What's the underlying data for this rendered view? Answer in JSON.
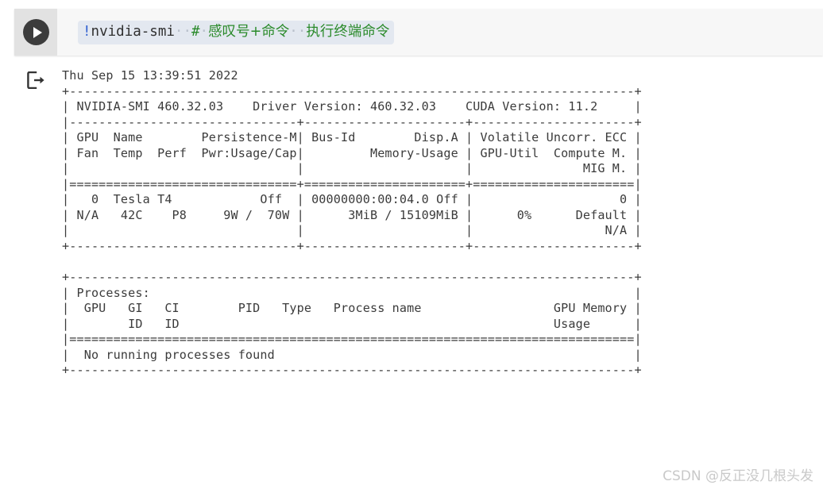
{
  "cell": {
    "run_button_icon": "play-icon",
    "output_icon": "output-export-icon",
    "code": {
      "bang": "!",
      "command": "nvidia-smi",
      "space_dots_1": "··",
      "hash": "#",
      "space_dot_2": "·",
      "comment_1": "感叹号+命令",
      "space_dots_3": "··",
      "comment_2": "执行终端命令",
      "full_text": "!nvidia-smi  # 感叹号+命令  执行终端命令"
    }
  },
  "output": {
    "timestamp": "Thu Sep 15 13:39:51 2022",
    "smi_version": "460.32.03",
    "driver_version": "460.32.03",
    "cuda_version": "11.2",
    "gpu": {
      "index": "0",
      "name": "Tesla T4",
      "persistence_m": "Off",
      "bus_id": "00000000:00:04.0",
      "disp_a": "Off",
      "volatile_uncorr_ecc": "0",
      "fan": "N/A",
      "temp": "42C",
      "perf": "P8",
      "pwr_usage_cap": "9W /  70W",
      "memory_usage": "3MiB / 15109MiB",
      "gpu_util": "0%",
      "compute_m": "Default",
      "mig_m": "N/A"
    },
    "processes": {
      "title": "Processes:",
      "columns": [
        "GPU",
        "GI",
        "CI",
        "PID",
        "Type",
        "Process name",
        "GPU Memory"
      ],
      "columns_line2": [
        "ID",
        "ID",
        "Usage"
      ],
      "message": "No running processes found"
    },
    "raw": "Thu Sep 15 13:39:51 2022\n+-----------------------------------------------------------------------------+\n| NVIDIA-SMI 460.32.03    Driver Version: 460.32.03    CUDA Version: 11.2     |\n|-------------------------------+----------------------+----------------------+\n| GPU  Name        Persistence-M| Bus-Id        Disp.A | Volatile Uncorr. ECC |\n| Fan  Temp  Perf  Pwr:Usage/Cap|         Memory-Usage | GPU-Util  Compute M. |\n|                               |                      |               MIG M. |\n|===============================+======================+======================|\n|   0  Tesla T4            Off  | 00000000:00:04.0 Off |                    0 |\n| N/A   42C    P8     9W /  70W |      3MiB / 15109MiB |      0%      Default |\n|                               |                      |                  N/A |\n+-------------------------------+----------------------+----------------------+\n                                                                               \n+-----------------------------------------------------------------------------+\n| Processes:                                                                  |\n|  GPU   GI   CI        PID   Type   Process name                  GPU Memory |\n|        ID   ID                                                   Usage      |\n|=============================================================================|\n|  No running processes found                                                 |\n+-----------------------------------------------------------------------------+"
  },
  "watermark": {
    "text": "CSDN @反正没几根头发"
  },
  "colors": {
    "gutter_bg": "#e2e2e2",
    "cell_bg": "#f7f7f7",
    "code_highlight": "#e3e8f0",
    "comment_green": "#2a8a2a",
    "bang_blue": "#2f5fd0",
    "output_text": "#3b3b3b",
    "run_button": "#3c3c3c",
    "watermark": "#c9c9c9"
  }
}
